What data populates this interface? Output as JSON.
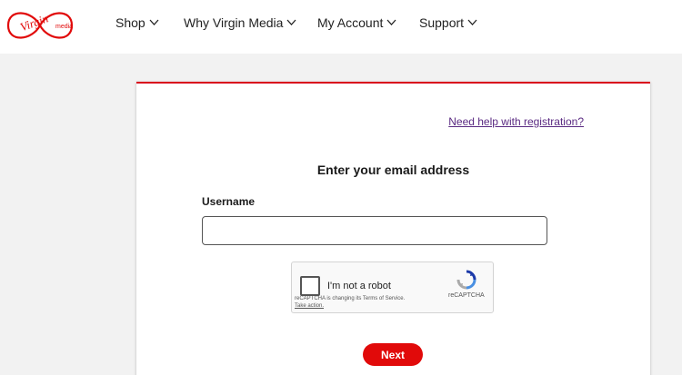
{
  "header": {
    "logo_icon": "virgin-media-logo",
    "nav": [
      {
        "label": "Shop"
      },
      {
        "label": "Why Virgin Media"
      },
      {
        "label": "My Account"
      },
      {
        "label": "Support"
      }
    ]
  },
  "form": {
    "help_link": "Need help with registration?",
    "title": "Enter your email address",
    "username_label": "Username",
    "username_value": "",
    "recaptcha": {
      "checkbox_label": "I'm not a robot",
      "brand": "reCAPTCHA",
      "notice": "reCAPTCHA is changing its Terms of Service.",
      "action": "Take action."
    },
    "next_label": "Next"
  },
  "colors": {
    "brand_red": "#e10a0a",
    "link_purple": "#5a2a82"
  }
}
